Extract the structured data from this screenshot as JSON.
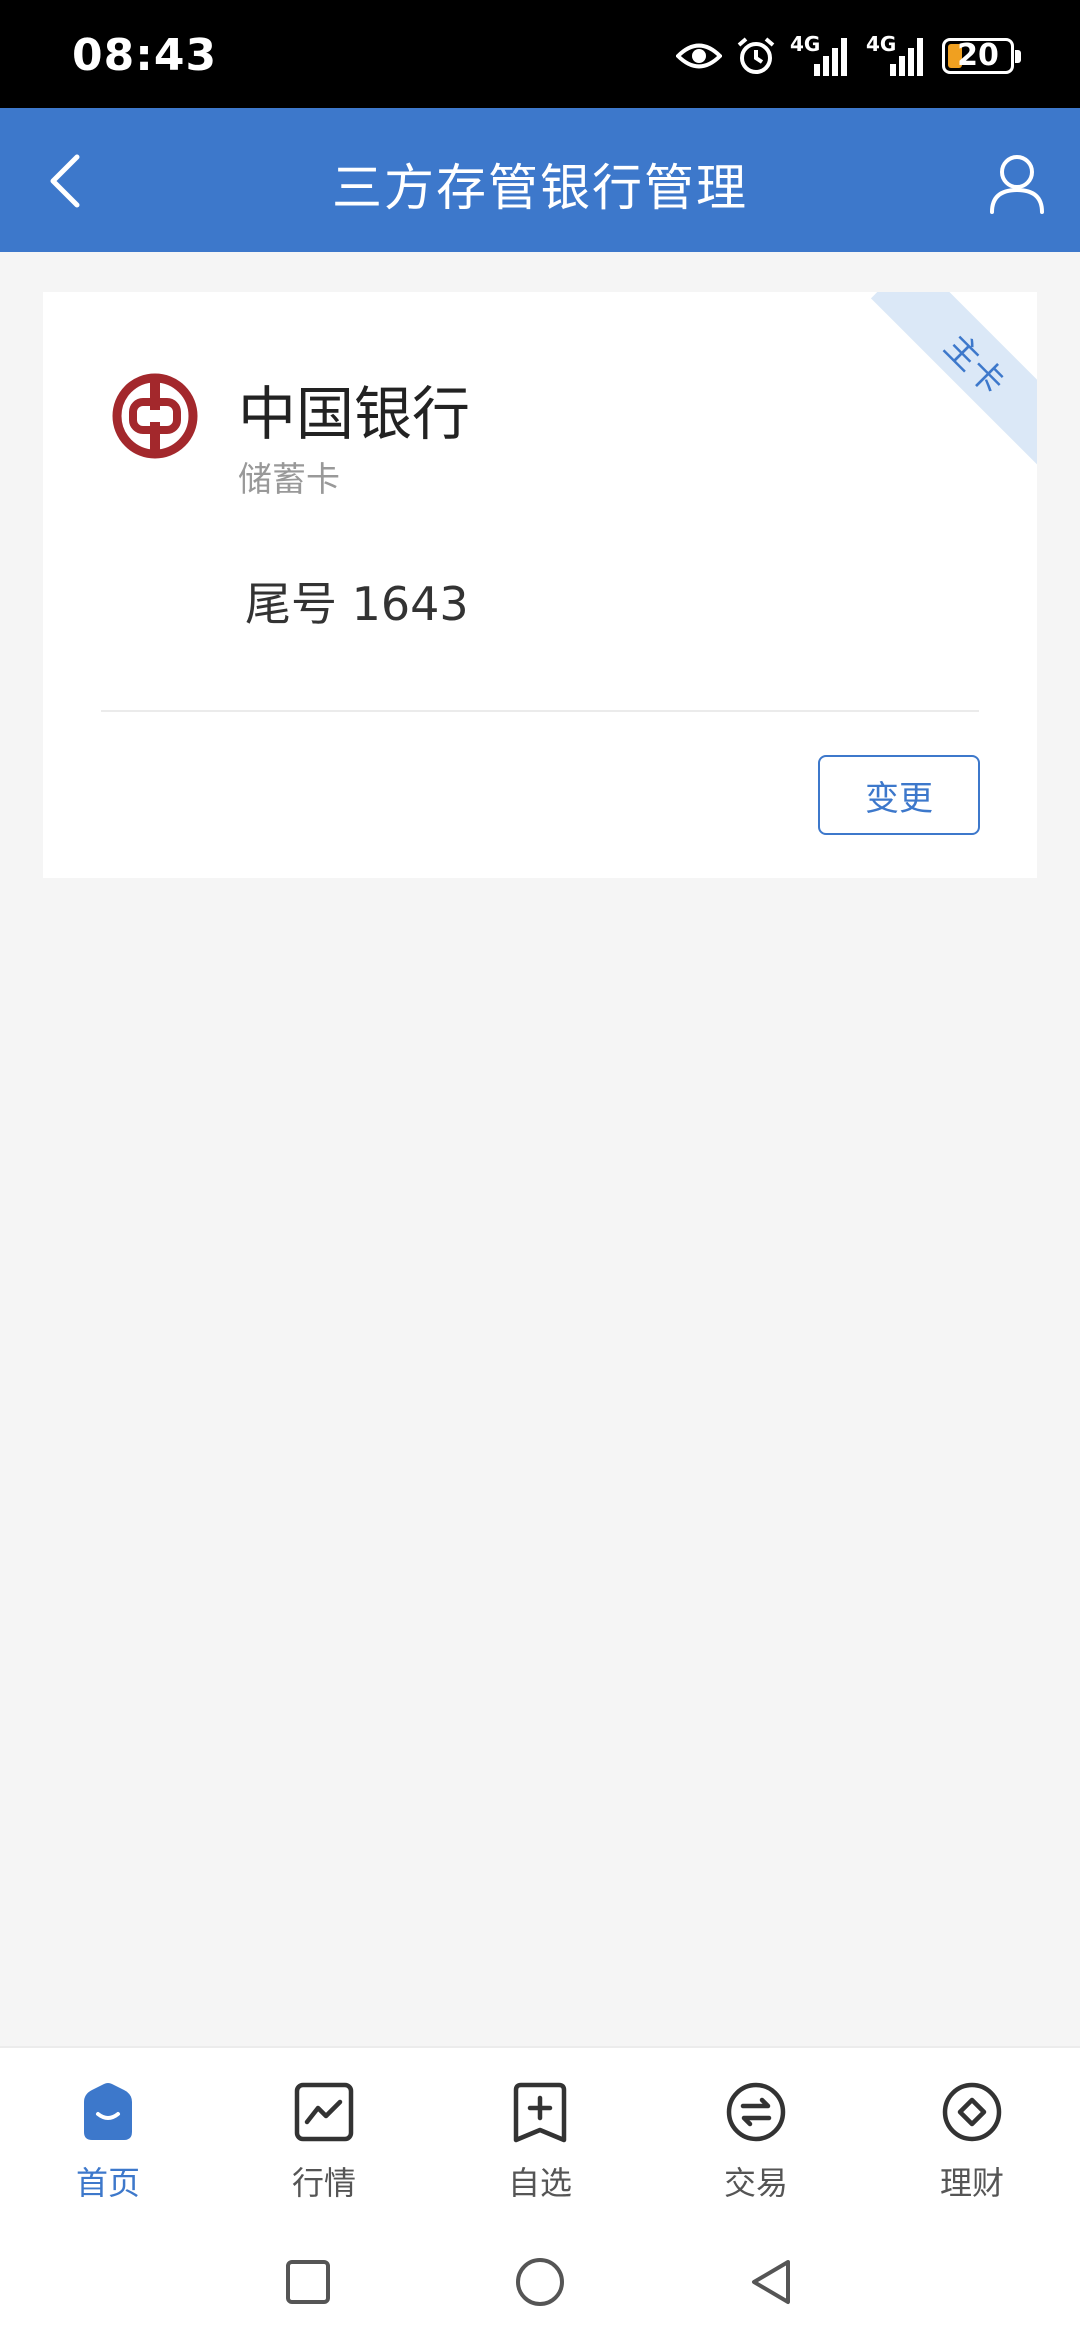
{
  "status_bar": {
    "time": "08:43",
    "network_1": "4G",
    "network_2": "4G",
    "battery": "20",
    "icons": [
      "eye-icon",
      "alarm-icon",
      "signal-icon",
      "signal-icon",
      "battery-icon"
    ]
  },
  "header": {
    "title": "三方存管银行管理",
    "back_icon": "chevron-left-icon",
    "user_icon": "user-icon"
  },
  "card": {
    "ribbon": "主卡",
    "bank_name": "中国银行",
    "card_type": "储蓄卡",
    "card_tail": "尾号 1643",
    "change_label": "变更",
    "logo_color": "#a3282c"
  },
  "tabs": [
    {
      "label": "首页",
      "icon": "home-icon",
      "active": true
    },
    {
      "label": "行情",
      "icon": "market-chart-icon",
      "active": false
    },
    {
      "label": "自选",
      "icon": "watchlist-add-icon",
      "active": false
    },
    {
      "label": "交易",
      "icon": "trade-exchange-icon",
      "active": false
    },
    {
      "label": "理财",
      "icon": "wealth-diamond-icon",
      "active": false
    }
  ],
  "colors": {
    "primary": "#3d78cb",
    "ribbon_bg": "#dbe8f7",
    "background": "#f5f5f5"
  }
}
